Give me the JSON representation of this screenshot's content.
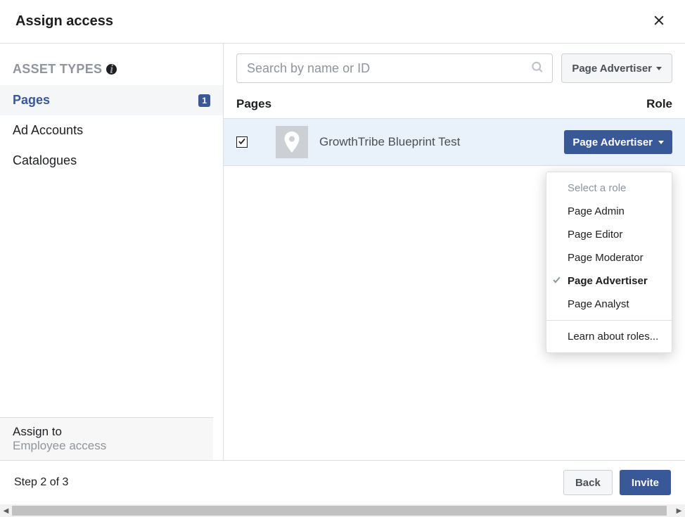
{
  "header": {
    "title": "Assign access"
  },
  "sidebar": {
    "heading": "ASSET TYPES",
    "items": [
      {
        "label": "Pages",
        "count": "1",
        "active": true
      },
      {
        "label": "Ad Accounts"
      },
      {
        "label": "Catalogues"
      }
    ],
    "assign_to_label": "Assign to",
    "assign_to_value": "Employee access"
  },
  "content": {
    "search_placeholder": "Search by name or ID",
    "filter_label": "Page Advertiser",
    "columns": {
      "pages": "Pages",
      "role": "Role"
    },
    "rows": [
      {
        "checked": true,
        "name": "GrowthTribe Blueprint Test",
        "role_button": "Page Advertiser"
      }
    ],
    "dropdown": {
      "placeholder": "Select a role",
      "options": [
        "Page Admin",
        "Page Editor",
        "Page Moderator",
        "Page Advertiser",
        "Page Analyst"
      ],
      "selected": "Page Advertiser",
      "learn_more": "Learn about roles..."
    }
  },
  "footer": {
    "step": "Step 2 of 3",
    "back": "Back",
    "invite": "Invite"
  }
}
